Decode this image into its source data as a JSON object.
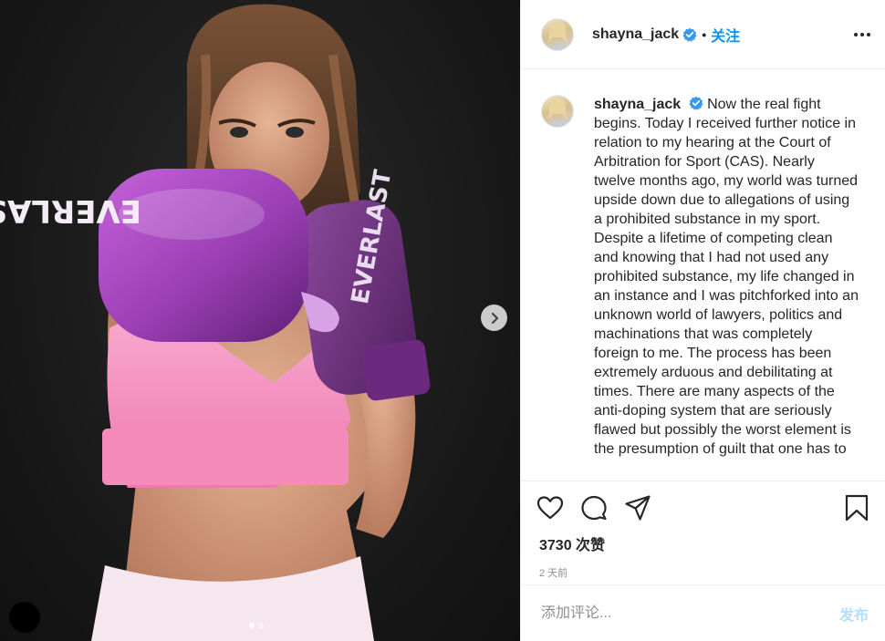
{
  "post": {
    "username": "shayna_jack",
    "separator": "•",
    "follow_label": "关注",
    "caption_text": "Now the real fight begins. Today I received further notice in relation to my hearing at the Court of Arbitration for Sport (CAS). Nearly twelve months ago, my world was turned upside down due to allegations of using a prohibited substance in my sport. Despite a lifetime of competing clean and knowing that I had not used any prohibited substance, my life changed in an instance and I was pitchforked into an unknown world of lawyers, politics and machinations that was completely foreign to me. The process has been extremely arduous and debilitating at times. There are many aspects of the anti-doping system that are seriously flawed but possibly the worst element is the presumption of guilt that one has to",
    "likes_text": "3730 次赞",
    "time_text": "2 天前",
    "comment_placeholder": "添加评论...",
    "post_button_label": "发布",
    "photo_glove_text": "EVERLAST"
  },
  "carousel": {
    "current": 1,
    "total": 2
  },
  "colors": {
    "link": "#0095f6",
    "verified": "#3897f0",
    "post_disabled": "#b2dffc",
    "glove": "#9b3fb5",
    "top": "#f48bb9"
  },
  "icons": [
    "verified-badge-icon",
    "more-options-icon",
    "heart-icon",
    "comment-icon",
    "share-icon",
    "bookmark-icon",
    "chevron-right-icon"
  ]
}
